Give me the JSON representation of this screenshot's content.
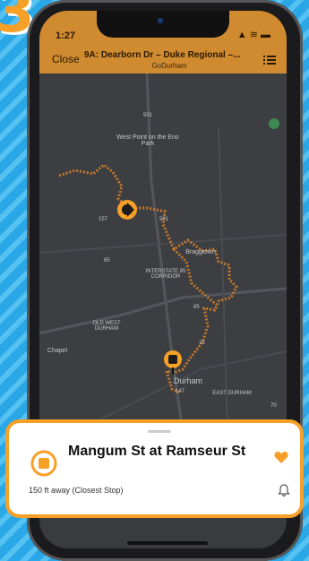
{
  "badge_digit": "3",
  "status_bar": {
    "time": "1:27",
    "icons": "▲ ≋ ▬"
  },
  "nav": {
    "close_label": "Close",
    "title": "9A: Dearborn Dr – Duke Regional –...",
    "subtitle": "GoDurham"
  },
  "map_labels": {
    "west_point": "West Point on the Eno Park",
    "braggtown": "Braggtown",
    "interstate": "INTERSTATE 85 CORRIDOR",
    "old_west": "OLD WEST DURHAM",
    "chapel": "Chapel",
    "durham": "Durham",
    "east_durham": "EAST DURHAM",
    "road_501_a": "501",
    "road_501_b": "501",
    "road_157": "157",
    "road_85_a": "85",
    "road_85_b": "85",
    "road_15": "15",
    "road_147": "147",
    "road_70": "70"
  },
  "stop_card": {
    "name": "Mangum St at Ramseur St",
    "distance": "150 ft away (Closest Stop)"
  },
  "colors": {
    "accent": "#f7a028",
    "route": "#c87a2a",
    "navbar": "#d08a2f"
  }
}
